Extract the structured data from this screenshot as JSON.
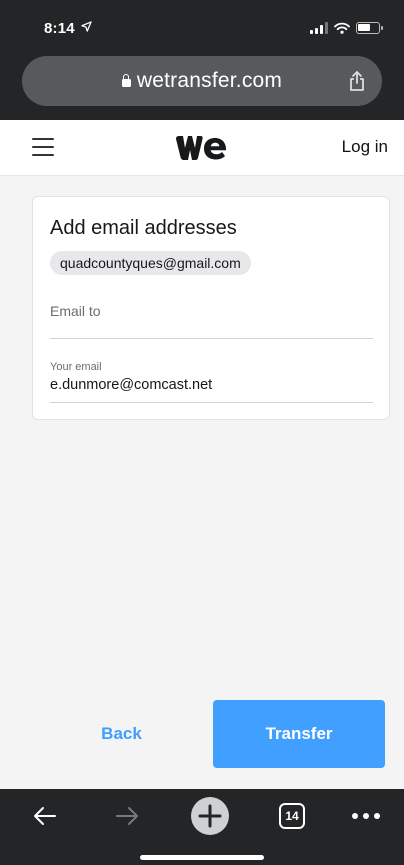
{
  "status_bar": {
    "time": "8:14",
    "icons": [
      "location-arrow-icon",
      "signal-icon",
      "wifi-icon",
      "battery-icon"
    ]
  },
  "browser": {
    "url": "wetransfer.com",
    "icons": [
      "lock-icon",
      "share-icon"
    ]
  },
  "header": {
    "menu_icon": "hamburger-menu-icon",
    "logo": "wetransfer-logo",
    "login_label": "Log in"
  },
  "form": {
    "title": "Add email addresses",
    "recipients": [
      "quadcountyques@gmail.com"
    ],
    "email_to": {
      "placeholder": "Email to",
      "value": ""
    },
    "your_email": {
      "label": "Your email",
      "value": "e.dunmore@comcast.net"
    }
  },
  "actions": {
    "back_label": "Back",
    "transfer_label": "Transfer"
  },
  "toolbar": {
    "tab_count": "14",
    "icons": [
      "back-arrow-icon",
      "forward-arrow-icon",
      "new-tab-plus-icon",
      "tabs-icon",
      "more-dots-icon"
    ]
  },
  "colors": {
    "accent": "#409fff",
    "chrome": "#242526",
    "url_bar": "#58595b",
    "page_bg": "#f4f4f5"
  }
}
